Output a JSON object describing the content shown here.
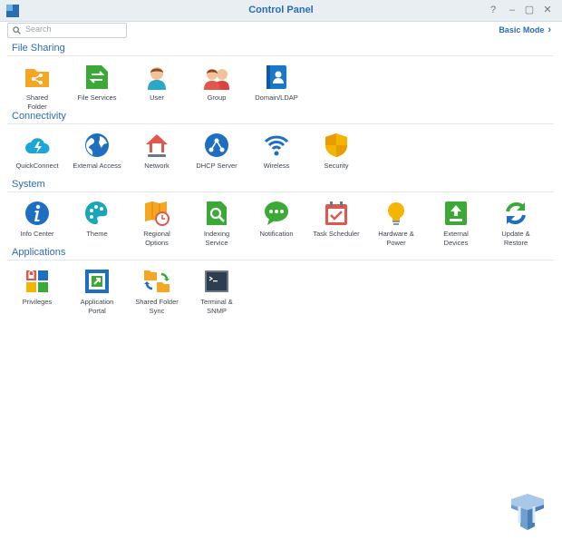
{
  "window": {
    "title": "Control Panel",
    "help_icon": "help-icon",
    "minimize_icon": "minimize-icon",
    "maximize_icon": "maximize-icon",
    "close_icon": "close-icon"
  },
  "search": {
    "placeholder": "Search"
  },
  "mode": {
    "label": "Basic Mode"
  },
  "sections": {
    "file_sharing": "File Sharing",
    "connectivity": "Connectivity",
    "system": "System",
    "applications": "Applications"
  },
  "items": {
    "shared_folder": "Shared\nFolder",
    "file_services": "File Services",
    "user": "User",
    "group": "Group",
    "domain_ldap": "Domain/LDAP",
    "quickconnect": "QuickConnect",
    "external_access": "External Access",
    "network": "Network",
    "dhcp_server": "DHCP Server",
    "wireless": "Wireless",
    "security": "Security",
    "info_center": "Info Center",
    "theme": "Theme",
    "regional_options": "Regional\nOptions",
    "indexing_service": "Indexing\nService",
    "notification": "Notification",
    "task_scheduler": "Task Scheduler",
    "hardware_power": "Hardware &\nPower",
    "external_devices": "External\nDevices",
    "update_restore": "Update &\nRestore",
    "privileges": "Privileges",
    "application_portal": "Application\nPortal",
    "shared_folder_sync": "Shared Folder\nSync",
    "terminal_snmp": "Terminal &\nSNMP"
  },
  "colors": {
    "accent": "#2a6db4",
    "titlebar": "#e9eef3"
  }
}
